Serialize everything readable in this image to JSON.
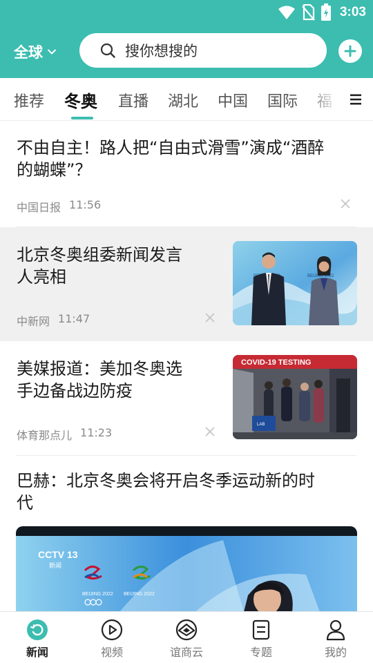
{
  "status": {
    "time": "3:03"
  },
  "header": {
    "region": "全球",
    "search_placeholder": "搜你想搜的",
    "accent": "#3cbdb0"
  },
  "tabs": [
    "推荐",
    "冬奥",
    "直播",
    "湖北",
    "中国",
    "国际",
    "福"
  ],
  "active_tab": "冬奥",
  "articles": [
    {
      "title_line1": "不由自主！路人把“自由式滑雪”演成“酒醉",
      "title_line2": "的蝴蝶”？",
      "source": "中国日报",
      "time": "11:56"
    },
    {
      "title_line1": "北京冬奥组委新闻发言",
      "title_line2": "人亮相",
      "source": "中新网",
      "time": "11:47",
      "thumb_text": "BEIJING 2022"
    },
    {
      "title_line1": "美媒报道：美加冬奥选",
      "title_line2": "手边备战边防疫",
      "source": "体育那点儿",
      "time": "11:23",
      "thumb_banner": "COVID-19 TESTING"
    },
    {
      "title_line1": "巴赫：北京冬奥会将开启冬季运动新的时",
      "title_line2": "代",
      "video_channel": "CCTV 13",
      "video_channel_sub": "新闻",
      "video_logo_text_1": "BEIJING 2022",
      "video_logo_text_2": "BEIJING 2022"
    }
  ],
  "bottom_nav": [
    {
      "label": "新闻",
      "icon": "news-icon"
    },
    {
      "label": "视频",
      "icon": "video-icon"
    },
    {
      "label": "谊商云",
      "icon": "cloud-icon"
    },
    {
      "label": "专题",
      "icon": "topic-icon"
    },
    {
      "label": "我的",
      "icon": "profile-icon"
    }
  ]
}
